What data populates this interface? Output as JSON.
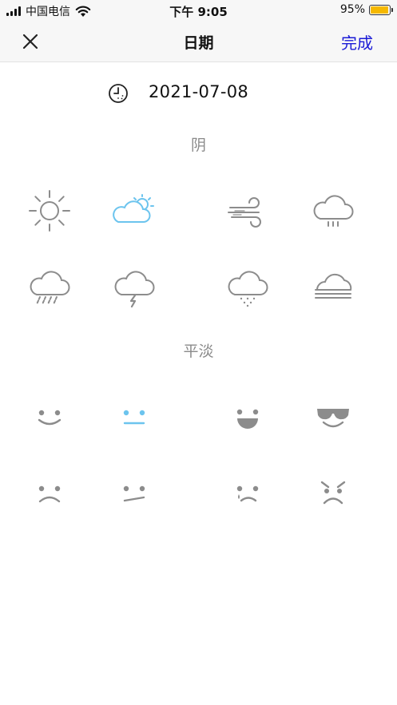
{
  "status_bar": {
    "carrier": "中国电信",
    "time": "下午 9:05",
    "battery_percent": "95%",
    "battery_level": 0.95,
    "icons": [
      "signal-icon",
      "wifi-icon",
      "battery-icon"
    ]
  },
  "nav": {
    "close_icon": "close-icon",
    "title": "日期",
    "done_label": "完成"
  },
  "date": {
    "icon": "clock-icon",
    "value": "2021-07-08"
  },
  "weather": {
    "selected_label": "阴",
    "selected_index": 1,
    "accent_color": "#6cc4ee",
    "icon_color": "#8c8c8c",
    "options": [
      "sun-icon",
      "partly-cloudy-icon",
      "wind-icon",
      "cloud-drizzle-icon",
      "cloud-heavy-rain-icon",
      "cloud-thunder-icon",
      "cloud-snow-icon",
      "fog-icon"
    ]
  },
  "mood": {
    "selected_label": "平淡",
    "selected_index": 1,
    "accent_color": "#6cc4ee",
    "icon_color": "#8c8c8c",
    "options": [
      "smile-face-icon",
      "neutral-face-icon",
      "laugh-face-icon",
      "cool-sunglasses-face-icon",
      "sad-face-icon",
      "unamused-face-icon",
      "crying-face-icon",
      "angry-face-icon"
    ]
  }
}
